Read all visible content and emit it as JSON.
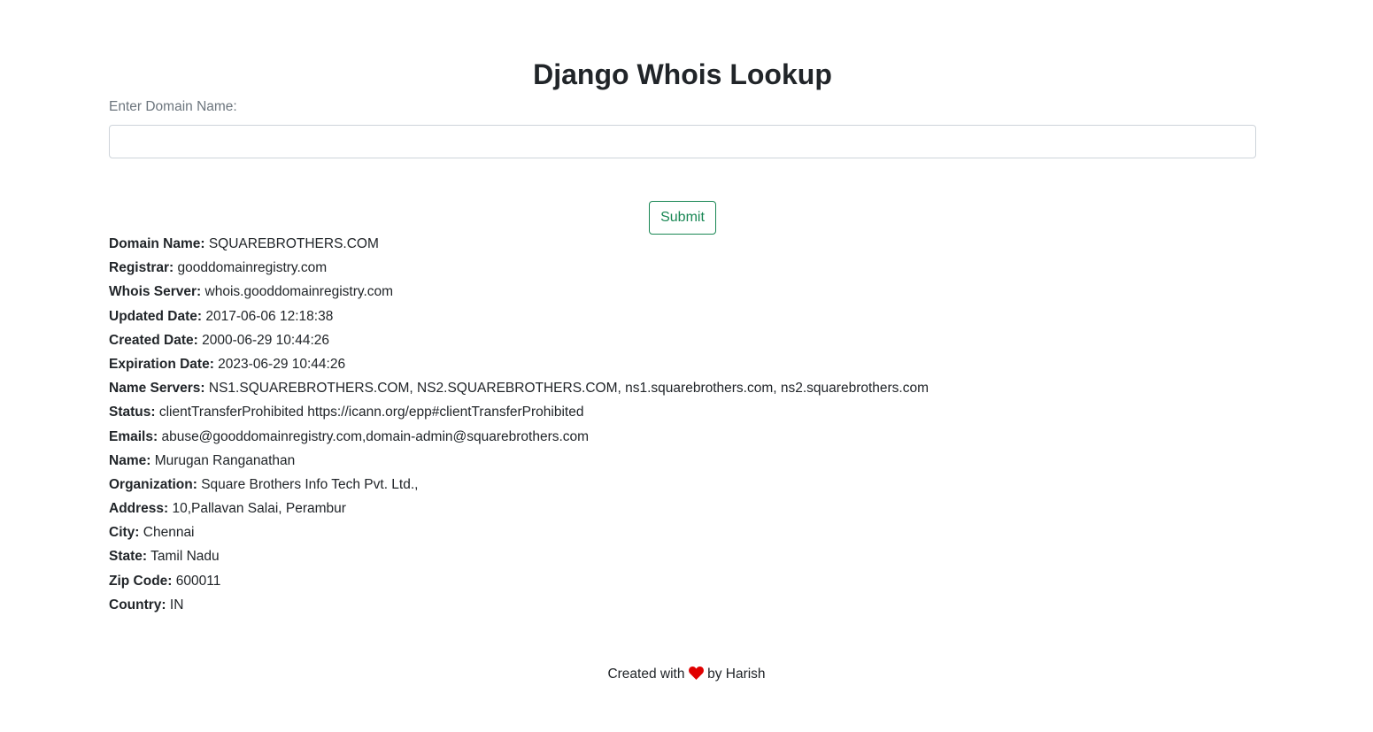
{
  "page": {
    "title": "Django Whois Lookup"
  },
  "form": {
    "label": "Enter Domain Name:",
    "input_value": "",
    "input_placeholder": "",
    "submit_label": "Submit"
  },
  "results": [
    {
      "label": "Domain Name:",
      "value": "SQUAREBROTHERS.COM"
    },
    {
      "label": "Registrar:",
      "value": "gooddomainregistry.com"
    },
    {
      "label": "Whois Server:",
      "value": "whois.gooddomainregistry.com"
    },
    {
      "label": "Updated Date:",
      "value": "2017-06-06 12:18:38"
    },
    {
      "label": "Created Date:",
      "value": "2000-06-29 10:44:26"
    },
    {
      "label": "Expiration Date:",
      "value": "2023-06-29 10:44:26"
    },
    {
      "label": "Name Servers:",
      "value": "NS1.SQUAREBROTHERS.COM, NS2.SQUAREBROTHERS.COM, ns1.squarebrothers.com, ns2.squarebrothers.com"
    },
    {
      "label": "Status:",
      "value": "clientTransferProhibited https://icann.org/epp#clientTransferProhibited"
    },
    {
      "label": "Emails:",
      "value": "abuse@gooddomainregistry.com,domain-admin@squarebrothers.com"
    },
    {
      "label": "Name:",
      "value": "Murugan Ranganathan"
    },
    {
      "label": "Organization:",
      "value": "Square Brothers Info Tech Pvt. Ltd.,"
    },
    {
      "label": "Address:",
      "value": "10,Pallavan Salai, Perambur"
    },
    {
      "label": "City:",
      "value": "Chennai"
    },
    {
      "label": "State:",
      "value": "Tamil Nadu"
    },
    {
      "label": "Zip Code:",
      "value": "600011"
    },
    {
      "label": "Country:",
      "value": "IN"
    }
  ],
  "footer": {
    "prefix": "Created with",
    "icon": "heart-icon",
    "suffix": "by Harish",
    "heart_color": "#e00000"
  },
  "colors": {
    "submit_accent": "#198754",
    "text": "#212529",
    "label_muted": "#6c757d"
  }
}
